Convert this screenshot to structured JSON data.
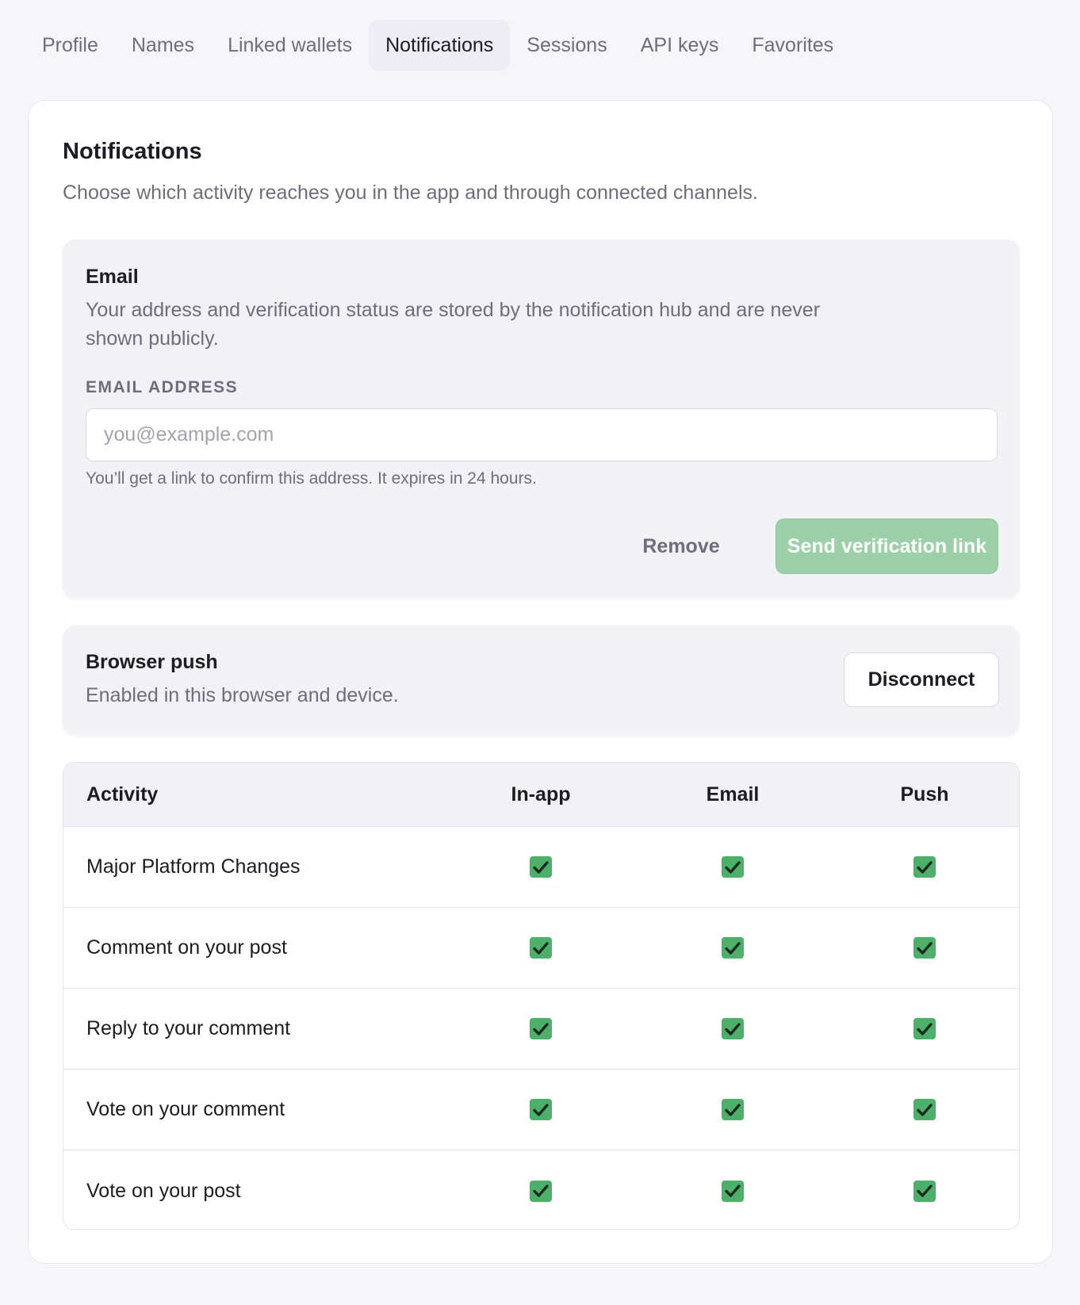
{
  "tabs": [
    {
      "label": "Profile"
    },
    {
      "label": "Names"
    },
    {
      "label": "Linked wallets"
    },
    {
      "label": "Notifications",
      "active": true
    },
    {
      "label": "Sessions"
    },
    {
      "label": "API keys"
    },
    {
      "label": "Favorites"
    }
  ],
  "card": {
    "title": "Notifications",
    "subtitle": "Choose which activity reaches you in the app and through connected channels."
  },
  "email": {
    "title": "Email",
    "description": "Your address and verification status are stored by the notification hub and are never shown publicly.",
    "field_label": "EMAIL ADDRESS",
    "value": "",
    "placeholder": "you@example.com",
    "hint": "You’ll get a link to confirm this address. It expires in 24 hours.",
    "remove_label": "Remove",
    "send_label": "Send verification link"
  },
  "push": {
    "title": "Browser push",
    "description": "Enabled in this browser and device.",
    "disconnect_label": "Disconnect"
  },
  "table": {
    "headers": [
      "Activity",
      "In-app",
      "Email",
      "Push"
    ],
    "rows": [
      {
        "label": "Major Platform Changes",
        "in_app": true,
        "email": true,
        "push": true
      },
      {
        "label": "Comment on your post",
        "in_app": true,
        "email": true,
        "push": true
      },
      {
        "label": "Reply to your comment",
        "in_app": true,
        "email": true,
        "push": true
      },
      {
        "label": "Vote on your comment",
        "in_app": true,
        "email": true,
        "push": true
      },
      {
        "label": "Vote on your post",
        "in_app": true,
        "email": true,
        "push": true
      }
    ]
  },
  "colors": {
    "accent_green": "#4caf6a",
    "send_button_disabled": "#9bd0a8",
    "text_primary": "#1c1c22",
    "text_muted": "#6d6d7d"
  }
}
